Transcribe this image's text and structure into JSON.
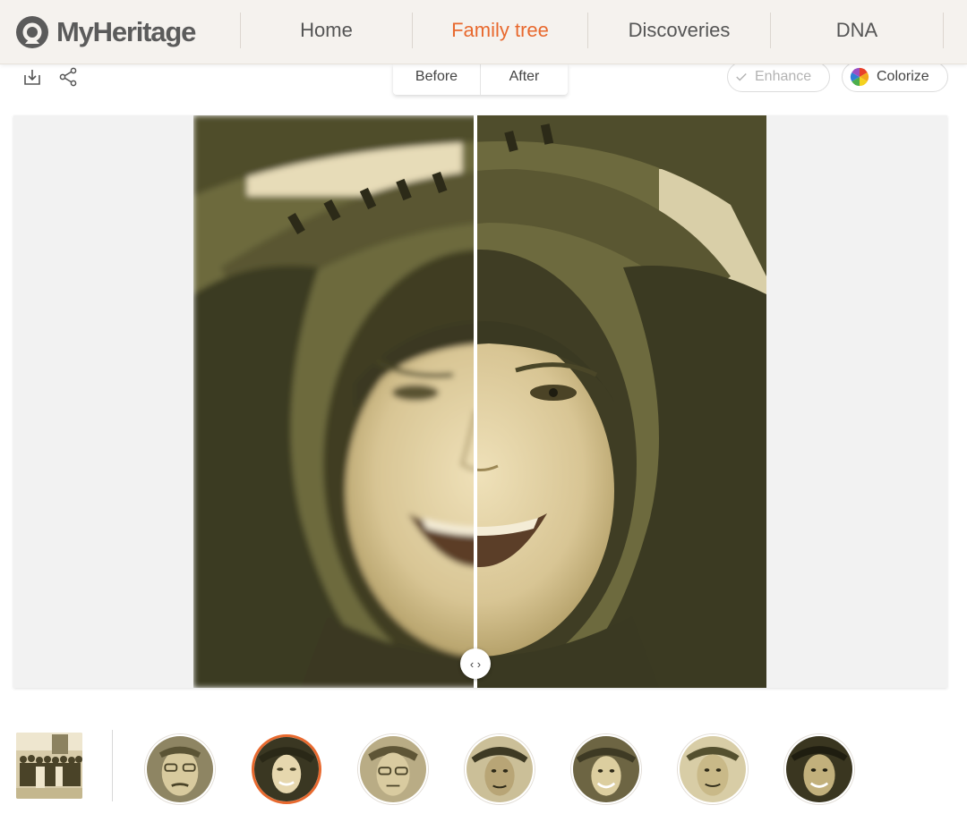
{
  "header": {
    "logo_text": "MyHeritage",
    "nav": [
      {
        "label": "Home",
        "active": false
      },
      {
        "label": "Family tree",
        "active": true
      },
      {
        "label": "Discoveries",
        "active": false
      },
      {
        "label": "DNA",
        "active": false
      }
    ],
    "accent_color": "#e8692e"
  },
  "toolbar": {
    "download_icon": "download-icon",
    "share_icon": "share-icon",
    "view_toggle": {
      "before_label": "Before",
      "after_label": "After"
    },
    "enhance_label": "Enhance",
    "colorize_label": "Colorize"
  },
  "viewer": {
    "mode": "before-after comparison",
    "slider_position": 0.5,
    "handle_icon": "chevrons-left-right-icon"
  },
  "thumbnails": {
    "full_photo_icon": "group-photo-thumbnail",
    "faces_count": 7,
    "selected_index": 1
  }
}
